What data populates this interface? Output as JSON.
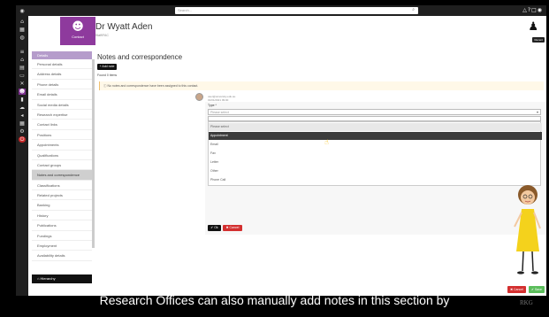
{
  "topbar": {
    "search_placeholder": "Search...",
    "icons": [
      "bell-icon",
      "help-icon",
      "window-icon",
      "settings-icon"
    ]
  },
  "rail": {
    "icons": [
      "home-icon",
      "calendar-icon",
      "dashboard-icon",
      "menu-icon",
      "institution-icon",
      "calendar-icon",
      "monitor-icon",
      "tools-icon",
      "contacts-icon",
      "document-icon",
      "cloud-icon",
      "send-icon",
      "grid-icon",
      "settings-icon",
      "power-icon"
    ]
  },
  "header": {
    "tile_label": "Contact",
    "name": "Dr Wyatt Aden",
    "subtitle": "Staff/FAC",
    "user_button": "Recent"
  },
  "nav": {
    "section": "Details",
    "items": [
      "Personal details",
      "Address details",
      "Phone details",
      "Email details",
      "Social media details",
      "Research expertise",
      "Contact links",
      "Positions",
      "Appointments",
      "Qualifications",
      "Contact groups",
      "Notes and correspondence",
      "Classifications",
      "Related projects",
      "Banking",
      "History",
      "Publications",
      "Fundings",
      "Employment",
      "Availability details"
    ],
    "active_index": 11,
    "hierarchy": "Hierarchy"
  },
  "main": {
    "title": "Notes and correspondence",
    "add_button": "Add note",
    "found": "Found 0 items",
    "notice": "No notes and correspondence have been assigned to this contact.",
    "meta_line1": "user@university.edu.au",
    "meta_line2": "01/01/2021 09:00",
    "type_label": "Type *",
    "select_value": "Please select",
    "options": [
      "Please select",
      "Appointment",
      "Email",
      "Fax",
      "Letter",
      "Other",
      "Phone Call"
    ],
    "selected_option": 1,
    "ok_button": "Ok",
    "cancel_button": "Cancel"
  },
  "footer": {
    "cancel_button": "Cancel",
    "save_button": "Save"
  },
  "caption": "Research Offices can also manually add notes in this section by",
  "watermark": "RKG",
  "colors": {
    "accent_purple": "#8e3a9d",
    "nav_header": "#b59ccb",
    "danger": "#d32f2f",
    "success": "#5bbd5b"
  }
}
